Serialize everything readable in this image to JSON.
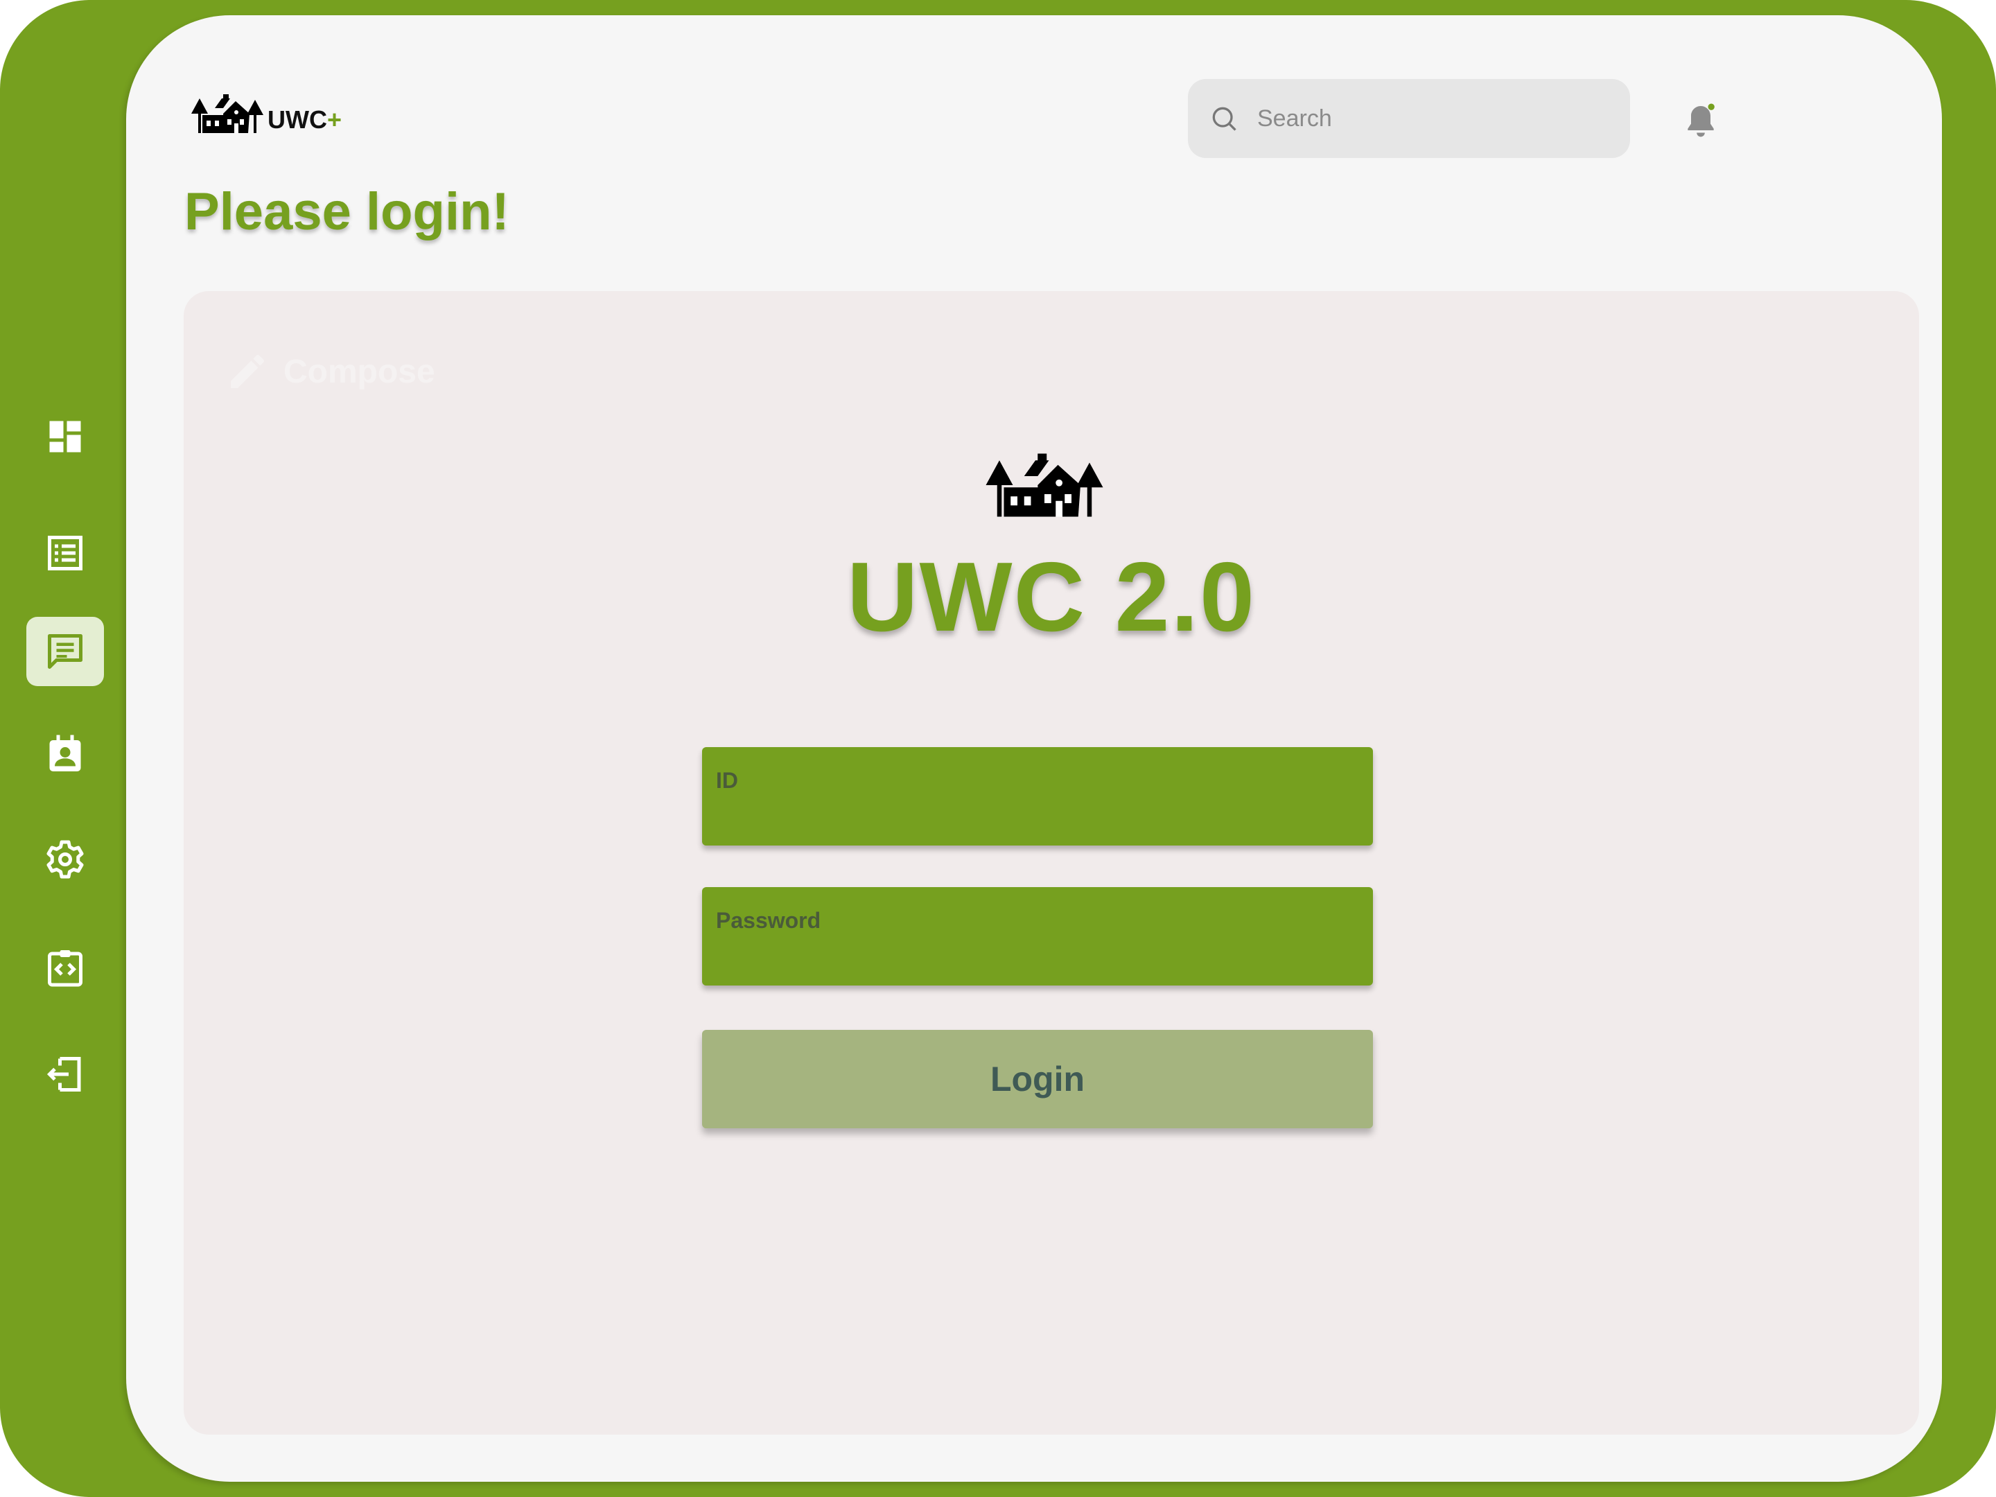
{
  "brand": {
    "name": "UWC",
    "suffix": "+"
  },
  "search": {
    "placeholder": "Search"
  },
  "page": {
    "title": "Please login!"
  },
  "sidebar": {
    "items": [
      {
        "icon": "dashboard-icon",
        "active": false
      },
      {
        "icon": "list-icon",
        "active": false
      },
      {
        "icon": "message-icon",
        "active": true
      },
      {
        "icon": "contact-calendar-icon",
        "active": false
      },
      {
        "icon": "gear-icon",
        "active": false
      },
      {
        "icon": "code-clipboard-icon",
        "active": false
      },
      {
        "icon": "logout-icon",
        "active": false
      }
    ]
  },
  "content": {
    "compose_ghost": "Compose",
    "app_title": "UWC 2.0",
    "id_label": "ID",
    "id_value": "",
    "password_label": "Password",
    "password_value": "",
    "login_label": "Login"
  },
  "colors": {
    "brand_green": "#76a01f",
    "panel": "#f6f6f6",
    "content_bg": "#f1ebeb",
    "login_button": "#a5b47f",
    "login_text": "#3f5a55"
  }
}
